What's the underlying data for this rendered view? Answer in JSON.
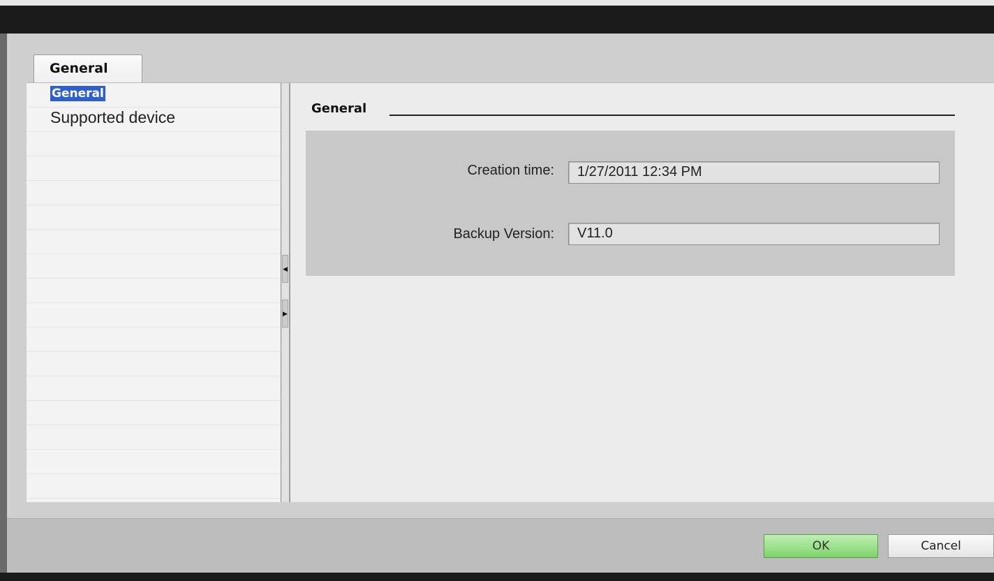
{
  "tab": {
    "label": "General"
  },
  "nav": {
    "items": [
      {
        "label": "General",
        "selected": true
      },
      {
        "label": "Supported device",
        "selected": false
      }
    ]
  },
  "section": {
    "title": "General"
  },
  "fields": {
    "creation_time": {
      "label": "Creation time:",
      "value": "1/27/2011 12:34 PM"
    },
    "backup_version": {
      "label": "Backup Version:",
      "value": "V11.0"
    }
  },
  "buttons": {
    "ok": "OK",
    "cancel": "Cancel"
  },
  "colors": {
    "selection": "#2d5fd2",
    "ok_button": "#7fd46a",
    "title_bar": "#1b1b1b"
  },
  "icons": {
    "collapse": "arrow-left-icon",
    "expand": "arrow-right-icon"
  }
}
